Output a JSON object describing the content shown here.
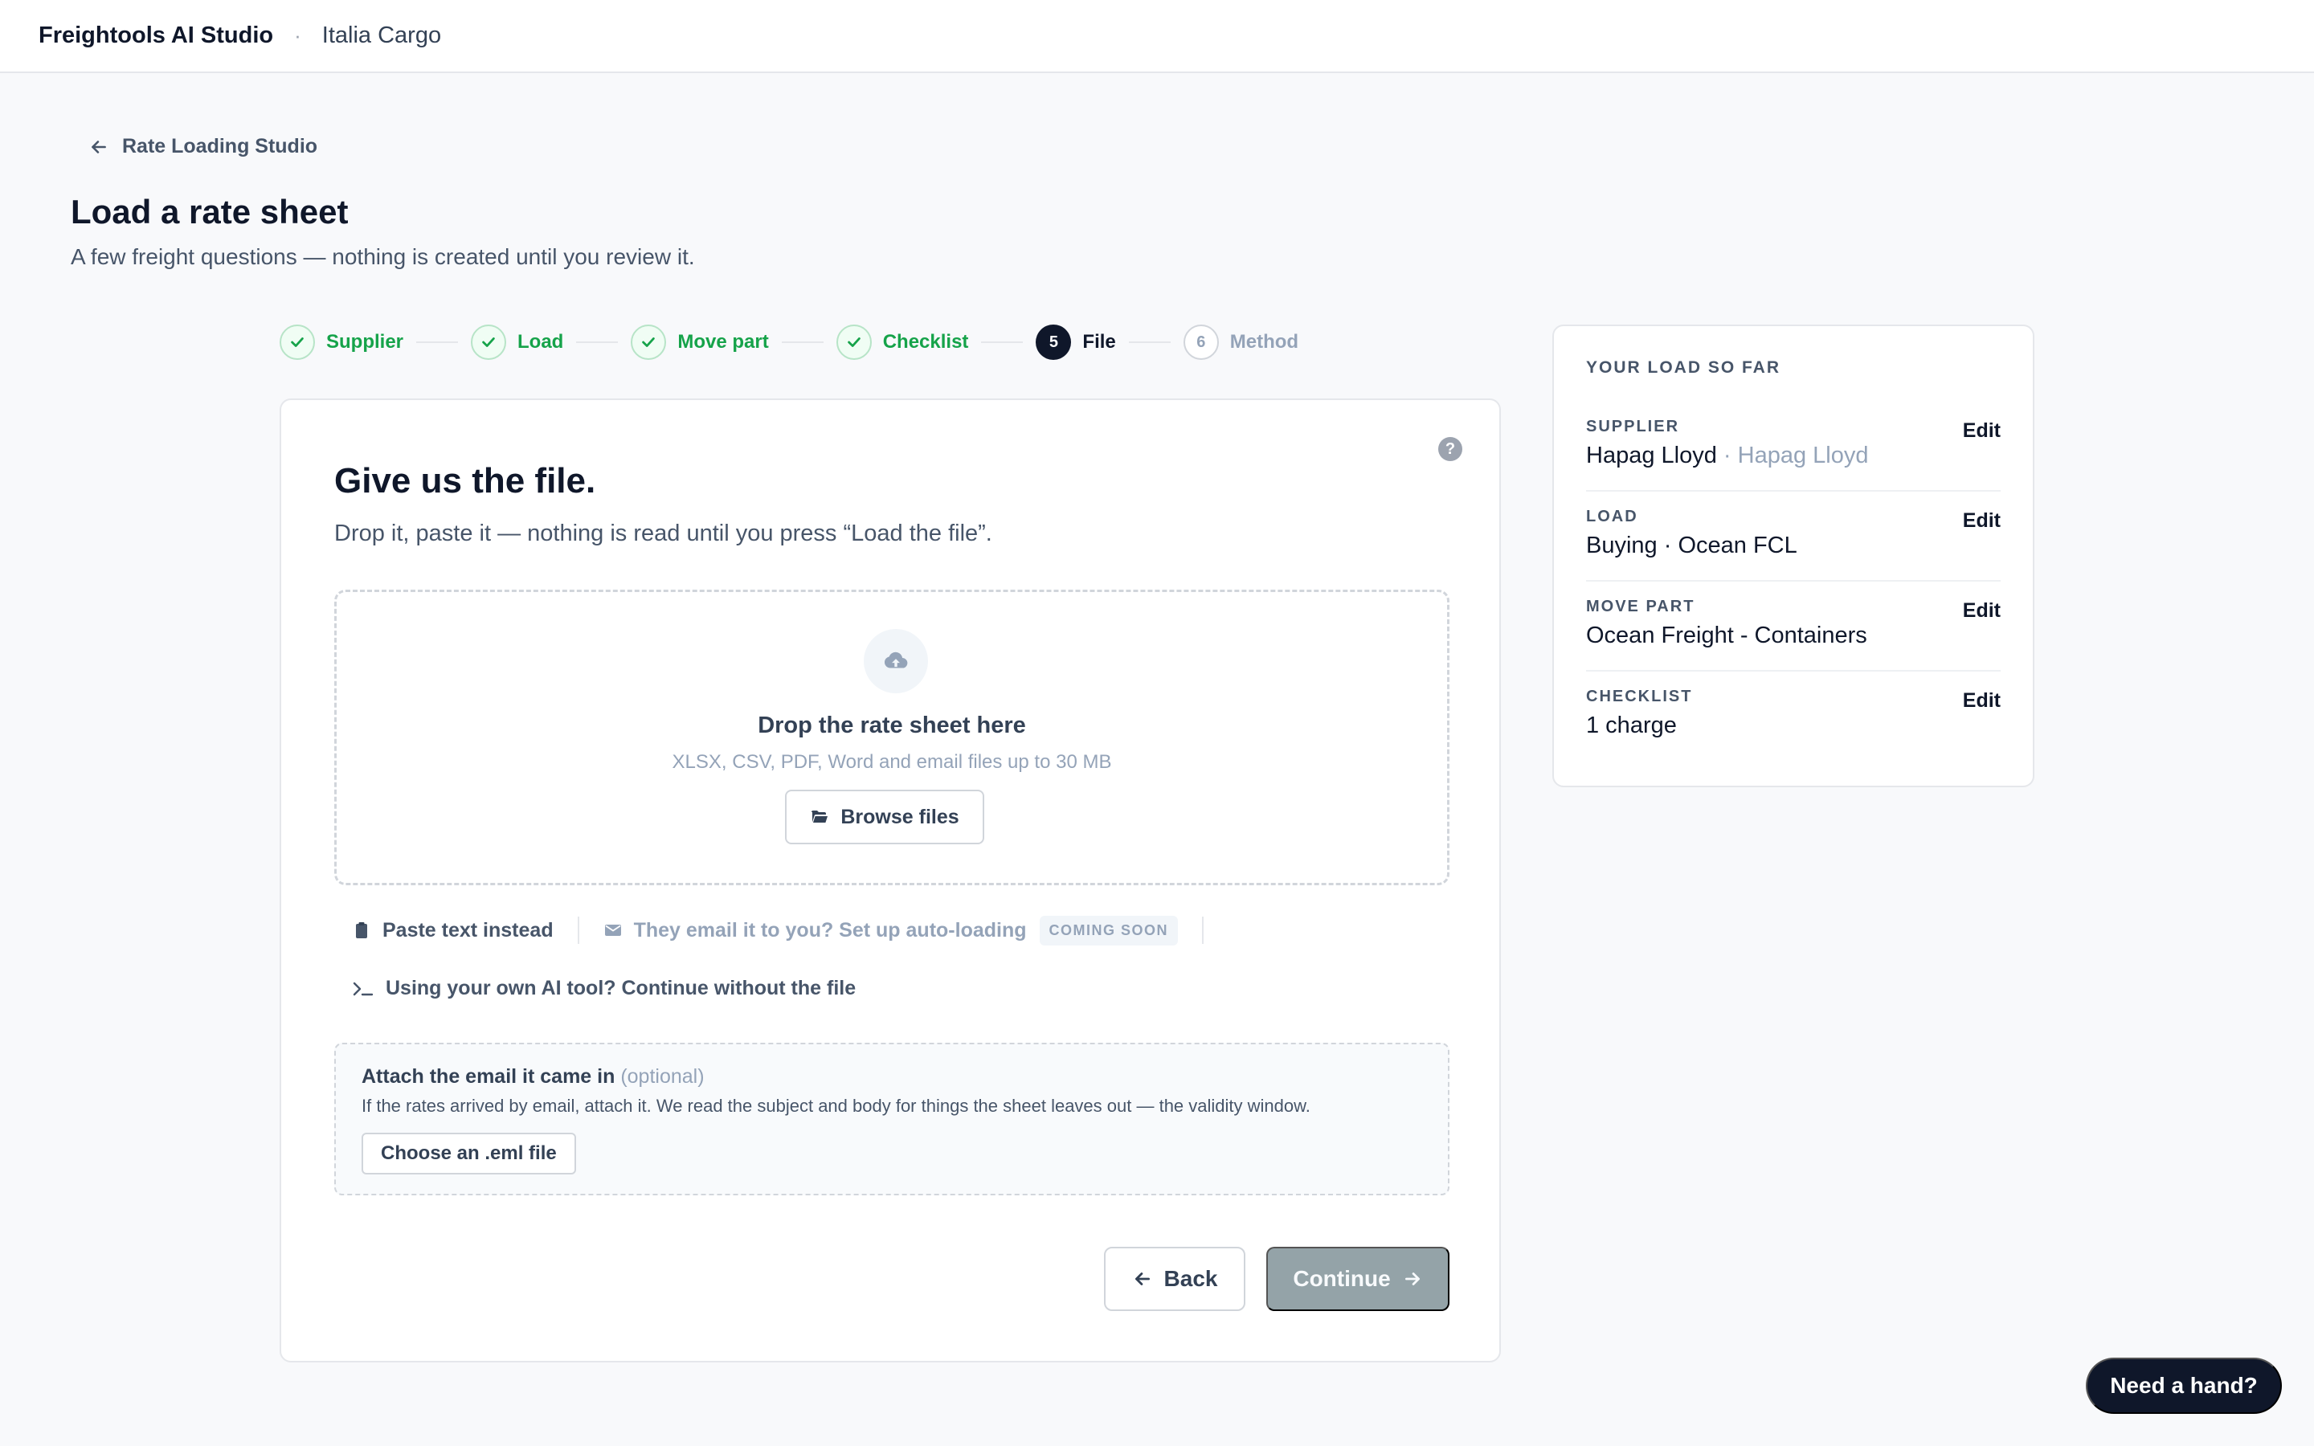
{
  "topbar": {
    "brand": "Freightools AI Studio",
    "separator": "·",
    "workspace": "Italia Cargo"
  },
  "back_link": {
    "label": "Rate Loading Studio"
  },
  "page": {
    "title": "Load a rate sheet",
    "subtitle": "A few freight questions — nothing is created until you review it."
  },
  "stepper": {
    "steps": [
      {
        "number": "1",
        "label": "Supplier",
        "state": "done"
      },
      {
        "number": "2",
        "label": "Load",
        "state": "done"
      },
      {
        "number": "3",
        "label": "Move part",
        "state": "done"
      },
      {
        "number": "4",
        "label": "Checklist",
        "state": "done"
      },
      {
        "number": "5",
        "label": "File",
        "state": "current"
      },
      {
        "number": "6",
        "label": "Method",
        "state": "todo"
      }
    ]
  },
  "card": {
    "help_icon": "?",
    "title": "Give us the file.",
    "subtitle": "Drop it, paste it — nothing is read until you press “Load the file”.",
    "dropzone": {
      "icon": "cloud-upload-icon",
      "title": "Drop the rate sheet here",
      "hint": "XLSX, CSV, PDF, Word and email files up to 30 MB",
      "browse_label": "Browse files"
    },
    "options": {
      "paste_label": "Paste text instead",
      "email_label": "They email it to you? Set up auto-loading",
      "email_badge": "COMING SOON",
      "ai_label": "Using your own AI tool? Continue without the file"
    },
    "email_attach": {
      "title": "Attach the email it came in",
      "optional": "(optional)",
      "description": "If the rates arrived by email, attach it. We read the subject and body for things the sheet leaves out — the validity window.",
      "button_label": "Choose an .eml file"
    },
    "back_label": "Back",
    "continue_label": "Continue"
  },
  "summary": {
    "heading": "YOUR LOAD SO FAR",
    "rows": [
      {
        "label": "SUPPLIER",
        "value": "Hapag Lloyd",
        "sub": "· Hapag Lloyd",
        "edit": "Edit"
      },
      {
        "label": "LOAD",
        "value": "Buying · Ocean FCL",
        "sub": "",
        "edit": "Edit"
      },
      {
        "label": "MOVE PART",
        "value": "Ocean Freight - Containers",
        "sub": "",
        "edit": "Edit"
      },
      {
        "label": "CHECKLIST",
        "value": "1 charge",
        "sub": "",
        "edit": "Edit"
      }
    ]
  },
  "help_fab": {
    "label": "Need a hand?"
  },
  "colors": {
    "success": "#16a34a",
    "primary": "#0f172a",
    "muted": "#94a3b8",
    "disabled_button": "#94a3a8"
  }
}
